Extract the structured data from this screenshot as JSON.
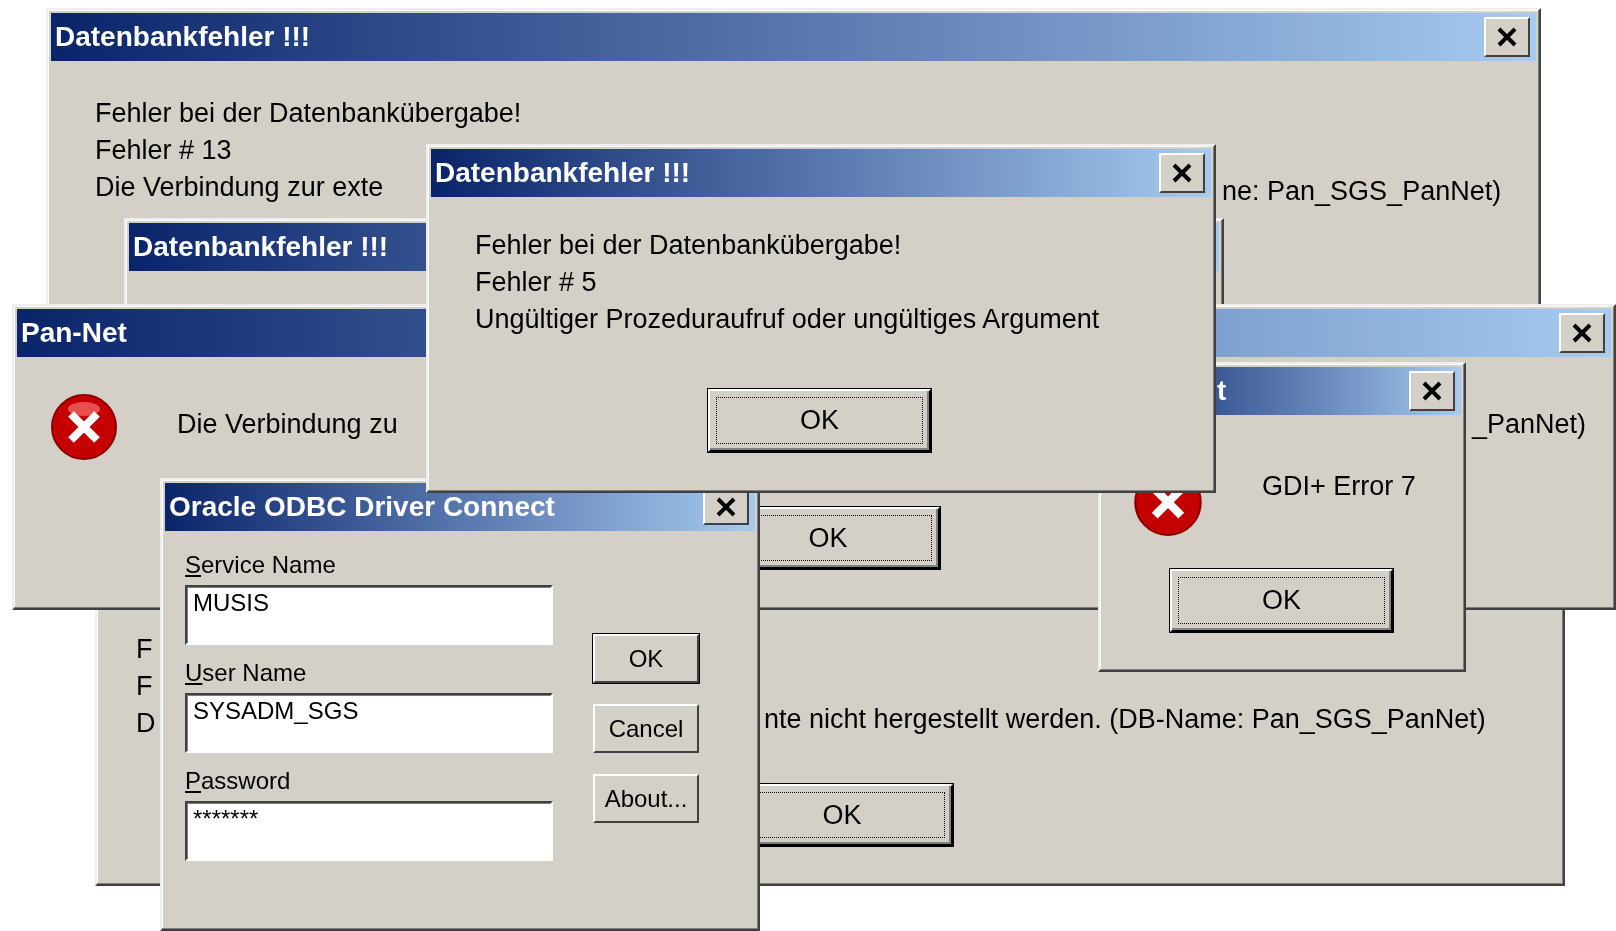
{
  "back_error": {
    "title": "Datenbankfehler !!!",
    "lines": [
      "Fehler bei der Datenbankübergabe!",
      "Fehler # 13",
      "Die Verbindung zur exte"
    ],
    "line_tail": "ne: Pan_SGS_PanNet)"
  },
  "second_error": {
    "title": "Datenbankfehler !!!"
  },
  "bottom_error": {
    "lines": [
      "F",
      "F",
      "D"
    ],
    "line_tail": "nte nicht hergestellt werden. (DB-Name: Pan_SGS_PanNet)",
    "button": "OK"
  },
  "pannet": {
    "title": "Pan-Net",
    "message": "Die Verbindung zu",
    "message_tail": "_PanNet)",
    "button": "OK"
  },
  "gdi": {
    "title": "t",
    "message": "GDI+ Error 7",
    "button": "OK"
  },
  "odbc": {
    "title": "Oracle ODBC Driver Connect",
    "fields": [
      {
        "label": "Service Name",
        "value": "MUSIS"
      },
      {
        "label": "User Name",
        "value": "SYSADM_SGS"
      },
      {
        "label": "Password",
        "value": "*******"
      }
    ],
    "buttons": [
      {
        "label": "OK",
        "default": true
      },
      {
        "label": "Cancel",
        "default": false
      },
      {
        "label": "About...",
        "default": false
      }
    ]
  },
  "front_error": {
    "title": "Datenbankfehler !!!",
    "lines": [
      "Fehler bei der Datenbankübergabe!",
      "Fehler # 5",
      "Ungültiger Prozeduraufruf oder ungültiges Argument"
    ],
    "button": "OK"
  }
}
